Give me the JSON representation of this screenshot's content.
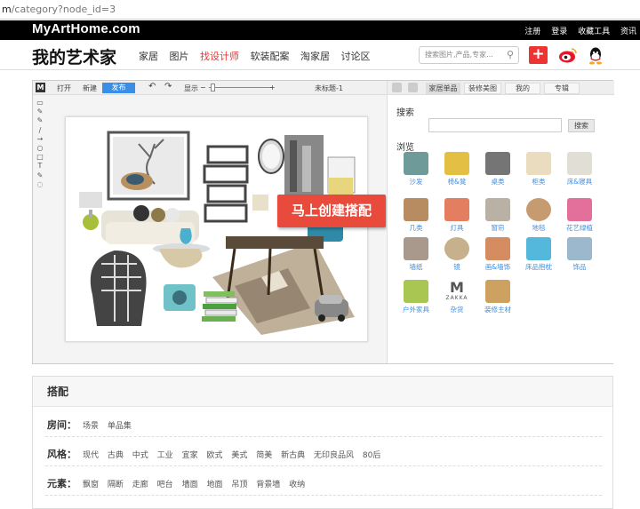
{
  "browser": {
    "url_prefix": "m",
    "url_rest": "/category?node_id=3"
  },
  "topbar": {
    "brand": "MyArtHome.com",
    "links": [
      "注册",
      "登录",
      "收藏工具",
      "资讯"
    ]
  },
  "nav": {
    "logo": "我的艺术家",
    "menu": [
      {
        "label": "家居"
      },
      {
        "label": "图片"
      },
      {
        "label": "找设计师"
      },
      {
        "label": "软装配案"
      },
      {
        "label": "淘家居"
      },
      {
        "label": "讨论区"
      }
    ],
    "search_placeholder": "搜索图片,产品,专家...",
    "plus_label": "+"
  },
  "editor": {
    "logo_letter": "M",
    "toolbar": {
      "open": "打开",
      "new": "新建",
      "publish": "发布",
      "display": "显示",
      "minus": "−",
      "plus": "+",
      "title": "未标题-1"
    },
    "left_tools": [
      "▭",
      "✎",
      "✎",
      "∕",
      "→",
      "○",
      "□",
      "T",
      "✎",
      "◌"
    ],
    "cta": "马上创建搭配",
    "panel": {
      "tabs": [
        "家居单品",
        "装修美图",
        "我的",
        "专辑"
      ],
      "search_label": "搜索",
      "search_button": "搜索",
      "browse_label": "浏览",
      "categories": [
        {
          "label": "沙发",
          "icon": "sofa-icon",
          "color": "#5f8f8f"
        },
        {
          "label": "椅&凳",
          "icon": "chair-icon",
          "color": "#e0b830"
        },
        {
          "label": "桌类",
          "icon": "desk-icon",
          "color": "#666666"
        },
        {
          "label": "柜类",
          "icon": "cabinet-icon",
          "color": "#e8d9b8"
        },
        {
          "label": "床&寝具",
          "icon": "bed-icon",
          "color": "#dedad0"
        },
        {
          "label": "几类",
          "icon": "table-icon",
          "color": "#b08050"
        },
        {
          "label": "灯具",
          "icon": "lamp-icon",
          "color": "#e07050"
        },
        {
          "label": "窗帘",
          "icon": "curtain-icon",
          "color": "#b0a89a"
        },
        {
          "label": "地毯",
          "icon": "rug-icon",
          "color": "#c09060"
        },
        {
          "label": "花艺绿植",
          "icon": "flower-icon",
          "color": "#e06090"
        },
        {
          "label": "墙纸",
          "icon": "wallpaper-icon",
          "color": "#9e8e80"
        },
        {
          "label": "镜",
          "icon": "mirror-icon",
          "color": "#c0a880"
        },
        {
          "label": "画&墙饰",
          "icon": "frame-icon",
          "color": "#d08050"
        },
        {
          "label": "床品抱枕",
          "icon": "pillow-icon",
          "color": "#40b0d8"
        },
        {
          "label": "饰品",
          "icon": "vase-icon",
          "color": "#90b0c8"
        },
        {
          "label": "户外家具",
          "icon": "umbrella-icon",
          "color": "#a0c040"
        },
        {
          "label": "杂货",
          "icon": "zakka-icon",
          "color": "#555555"
        },
        {
          "label": "装修主材",
          "icon": "wood-icon",
          "color": "#c89850"
        }
      ],
      "zakka_text": "ZAKKA",
      "zakka_letter": "M"
    }
  },
  "filter": {
    "title": "搭配",
    "rows": [
      {
        "key": "房间：",
        "values": [
          "场景",
          "单品集"
        ]
      },
      {
        "key": "风格：",
        "values": [
          "现代",
          "古典",
          "中式",
          "工业",
          "宜家",
          "欧式",
          "美式",
          "简美",
          "新古典",
          "无印良品风",
          "80后"
        ]
      },
      {
        "key": "元素：",
        "values": [
          "飘窗",
          "隔断",
          "走廊",
          "吧台",
          "墙面",
          "地面",
          "吊顶",
          "背景墙",
          "收纳"
        ]
      }
    ]
  },
  "colors": {
    "accent": "#e84a3c",
    "link": "#3a8ee6"
  }
}
